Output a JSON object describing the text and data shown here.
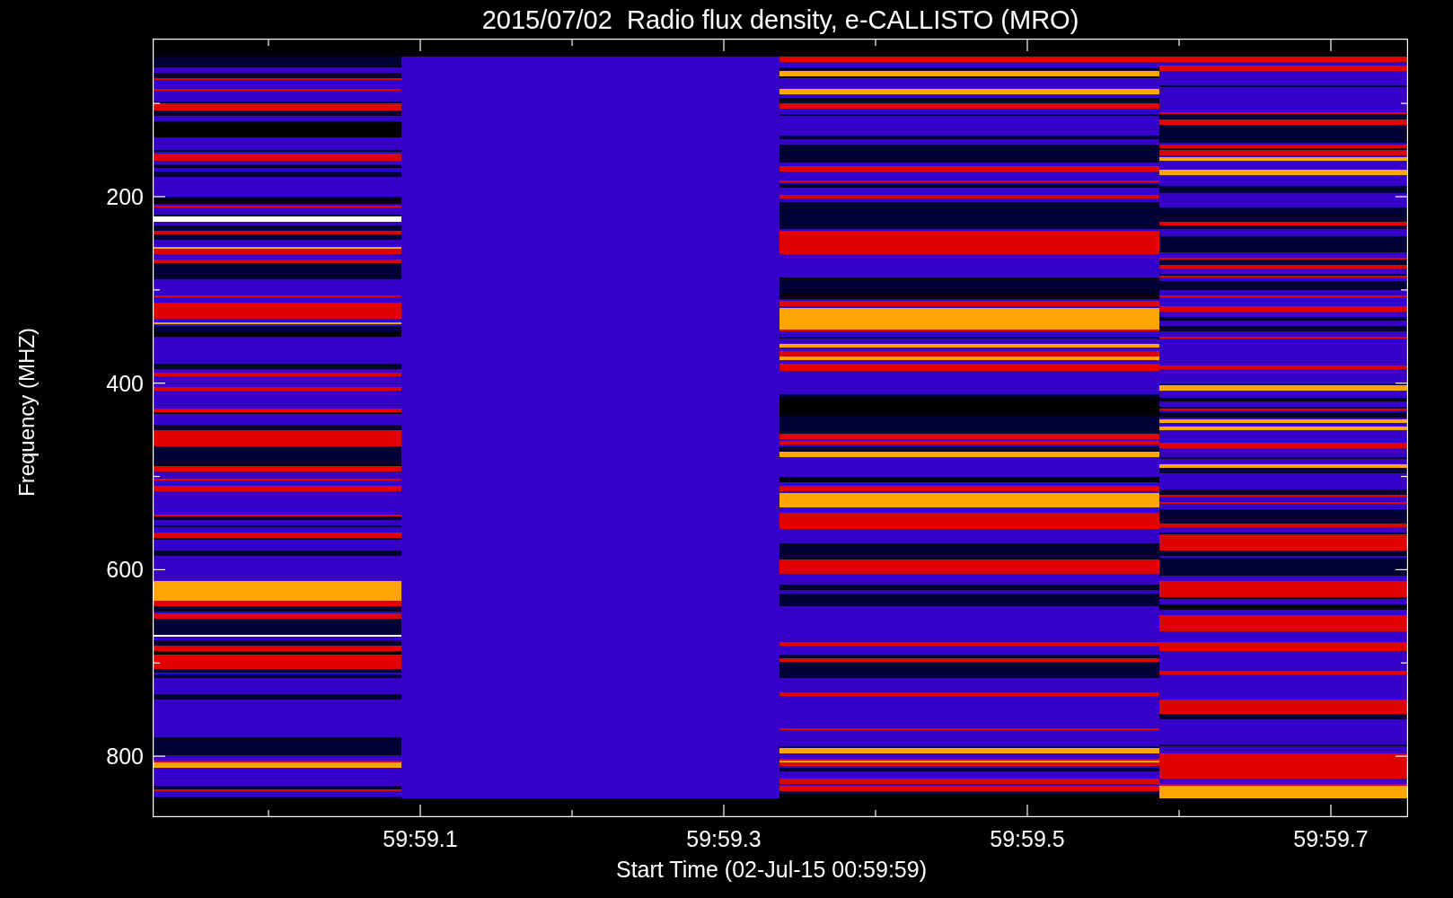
{
  "title": "2015/07/02  Radio flux density, e-CALLISTO (MRO)",
  "y_axis": {
    "label": "Frequency (MHZ)",
    "tick_labels": [
      "200",
      "400",
      "600",
      "800"
    ]
  },
  "x_axis": {
    "label": "Start Time (02-Jul-15 00:59:59)",
    "tick_labels": [
      "59:59.1",
      "59:59.3",
      "59:59.5",
      "59:59.7"
    ]
  }
}
